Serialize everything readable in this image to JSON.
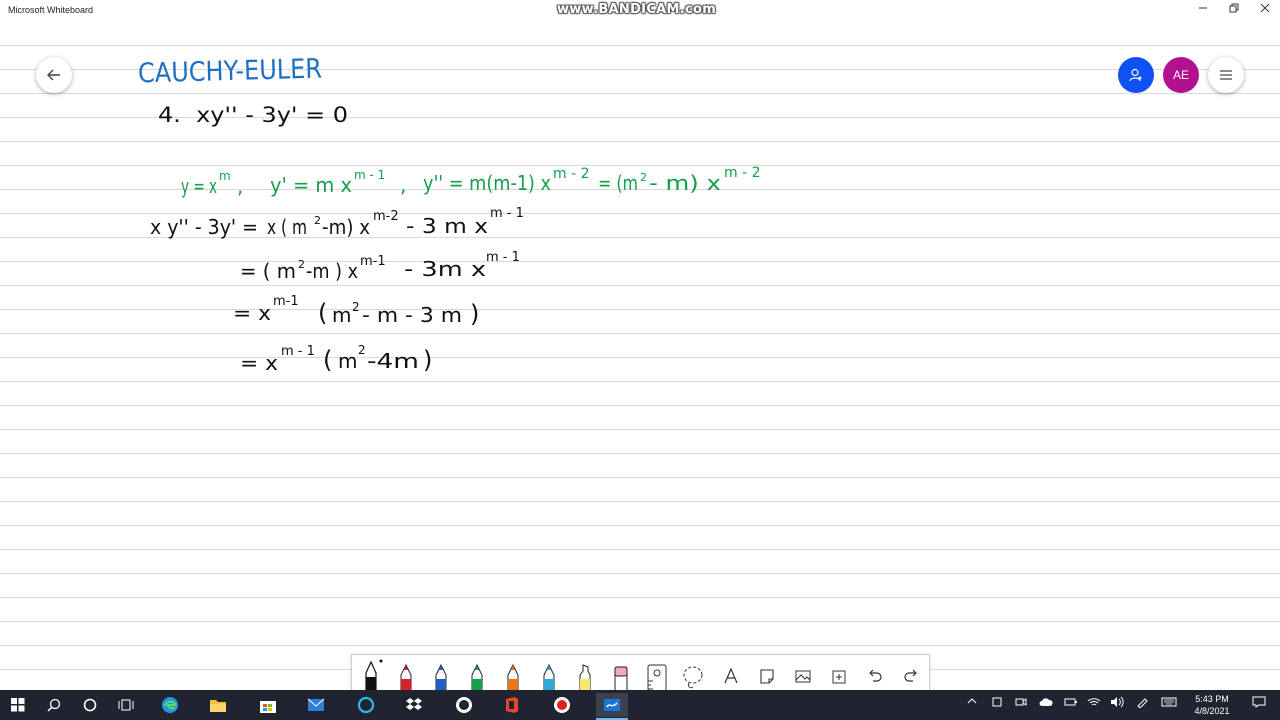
{
  "window": {
    "title": "Microsoft Whiteboard",
    "watermark": "www.BANDICAM.com"
  },
  "header": {
    "avatar_initials": "AE"
  },
  "board": {
    "heading": "CAUCHY-EULER",
    "problem": "4.  xy'' - 3y' = 0",
    "substitution": "y = x^m ,  y' = m x^(m-1) ,  y'' = m(m-1) x^(m-2) = (m^2 - m) x^(m-2)",
    "step1": "xy'' - 3y' = x(m^2-m) x^(m-2) - 3m x^(m-1)",
    "step2": "= (m^2-m) x^(m-1) - 3m x^(m-1)",
    "step3": "= x^(m-1) ( m^2 - m - 3m )",
    "step4": "= x^(m-1) ( m^2 - 4m )",
    "ink_colors": {
      "blue": "#1f6fc7",
      "black": "#111111",
      "green": "#13a04a"
    }
  },
  "toolbar": {
    "tools": [
      {
        "name": "pen-black",
        "color": "#111111"
      },
      {
        "name": "pen-red",
        "color": "#d6232a"
      },
      {
        "name": "pen-blue",
        "color": "#1f5fc7"
      },
      {
        "name": "pen-green",
        "color": "#12a14b"
      },
      {
        "name": "pen-orange",
        "color": "#e8741b"
      },
      {
        "name": "pen-cyan",
        "color": "#2fa8d8"
      },
      {
        "name": "highlighter",
        "color": "#f5e86a"
      },
      {
        "name": "eraser",
        "color": "#f2a7c6"
      },
      {
        "name": "ruler-icon"
      },
      {
        "name": "lasso-icon"
      },
      {
        "name": "text-icon",
        "glyph": "A"
      },
      {
        "name": "note-icon"
      },
      {
        "name": "image-icon"
      },
      {
        "name": "add-icon"
      },
      {
        "name": "undo-icon"
      },
      {
        "name": "redo-icon"
      }
    ]
  },
  "taskbar": {
    "time": "5:43 PM",
    "date": "4/8/2021"
  }
}
